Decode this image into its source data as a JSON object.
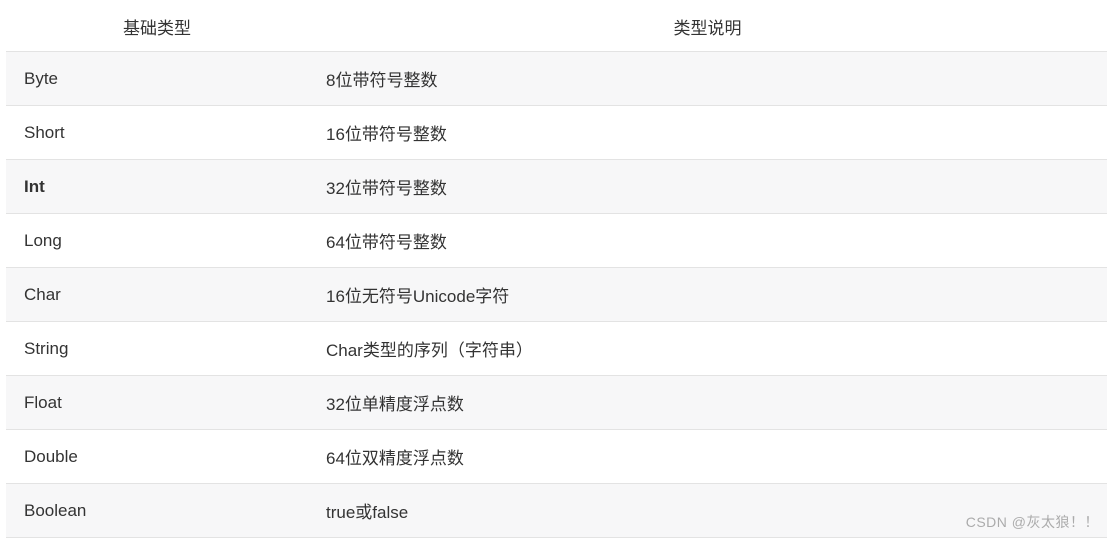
{
  "table": {
    "headers": {
      "type": "基础类型",
      "description": "类型说明"
    },
    "rows": [
      {
        "type": "Byte",
        "description": "8位带符号整数",
        "bold": false
      },
      {
        "type": "Short",
        "description": "16位带符号整数",
        "bold": false
      },
      {
        "type": "Int",
        "description": "32位带符号整数",
        "bold": true
      },
      {
        "type": "Long",
        "description": "64位带符号整数",
        "bold": false
      },
      {
        "type": "Char",
        "description": "16位无符号Unicode字符",
        "bold": false
      },
      {
        "type": "String",
        "description": "Char类型的序列（字符串）",
        "bold": false
      },
      {
        "type": "Float",
        "description": "32位单精度浮点数",
        "bold": false
      },
      {
        "type": "Double",
        "description": "64位双精度浮点数",
        "bold": false
      },
      {
        "type": "Boolean",
        "description": "true或false",
        "bold": false
      }
    ]
  },
  "watermark": "CSDN @灰太狼！！"
}
